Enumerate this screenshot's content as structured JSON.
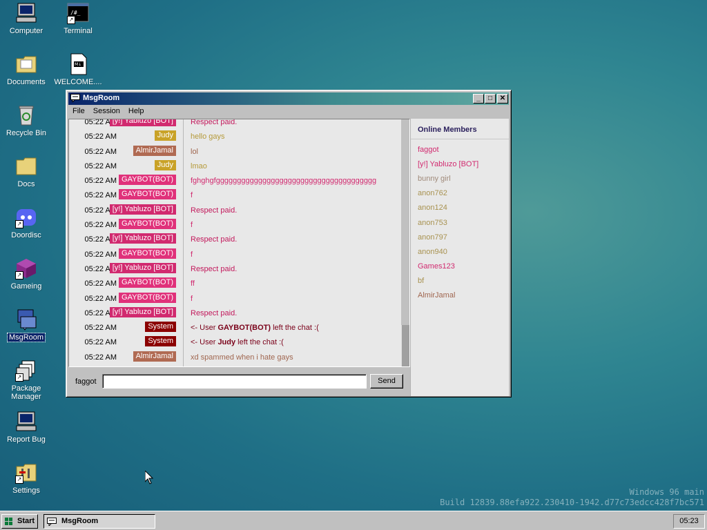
{
  "desktop": {
    "icons": [
      {
        "label": "Computer"
      },
      {
        "label": "Terminal"
      },
      {
        "label": "Documents"
      },
      {
        "label": "WELCOME...."
      },
      {
        "label": "Recycle Bin"
      },
      {
        "label": "Docs"
      },
      {
        "label": "Doordisc"
      },
      {
        "label": "Gameing"
      },
      {
        "label": "MsgRoom"
      },
      {
        "label": "Package Manager"
      },
      {
        "label": "Report Bug"
      },
      {
        "label": "Settings"
      }
    ],
    "watermark": {
      "line1": "Windows 96 main",
      "line2": "Build 12839.88efa922.230410-1942.d77c73edcc428f7bc571"
    }
  },
  "window": {
    "title": "MsgRoom",
    "menu": [
      "File",
      "Session",
      "Help"
    ],
    "messages": [
      {
        "time": "05:22 AM",
        "user": "[y!] Yabluzo [BOT]",
        "user_color": "#d12a6f",
        "text": "Respect paid.",
        "text_color": "#c2185b"
      },
      {
        "time": "05:22 AM",
        "user": "Judy",
        "user_color": "#c9a227",
        "text": "hello gays",
        "text_color": "#b59a3a"
      },
      {
        "time": "05:22 AM",
        "user": "AlmirJamal",
        "user_color": "#b06a52",
        "text": "lol",
        "text_color": "#a0664f"
      },
      {
        "time": "05:22 AM",
        "user": "Judy",
        "user_color": "#c9a227",
        "text": "lmao",
        "text_color": "#b59a3a"
      },
      {
        "time": "05:22 AM",
        "user": "GAYBOT(BOT)",
        "user_color": "#e0317a",
        "text": "fghghgfgggggggggggggggggggggggggggggggggggggg",
        "text_color": "#d12a6f"
      },
      {
        "time": "05:22 AM",
        "user": "GAYBOT(BOT)",
        "user_color": "#e0317a",
        "text": "f",
        "text_color": "#d12a6f"
      },
      {
        "time": "05:22 AM",
        "user": "[y!] Yabluzo [BOT]",
        "user_color": "#d12a6f",
        "text": "Respect paid.",
        "text_color": "#c2185b"
      },
      {
        "time": "05:22 AM",
        "user": "GAYBOT(BOT)",
        "user_color": "#e0317a",
        "text": "f",
        "text_color": "#d12a6f"
      },
      {
        "time": "05:22 AM",
        "user": "[y!] Yabluzo [BOT]",
        "user_color": "#d12a6f",
        "text": "Respect paid.",
        "text_color": "#c2185b"
      },
      {
        "time": "05:22 AM",
        "user": "GAYBOT(BOT)",
        "user_color": "#e0317a",
        "text": "f",
        "text_color": "#d12a6f"
      },
      {
        "time": "05:22 AM",
        "user": "[y!] Yabluzo [BOT]",
        "user_color": "#d12a6f",
        "text": "Respect paid.",
        "text_color": "#c2185b"
      },
      {
        "time": "05:22 AM",
        "user": "GAYBOT(BOT)",
        "user_color": "#e0317a",
        "text": "ff",
        "text_color": "#d12a6f"
      },
      {
        "time": "05:22 AM",
        "user": "GAYBOT(BOT)",
        "user_color": "#e0317a",
        "text": "f",
        "text_color": "#d12a6f"
      },
      {
        "time": "05:22 AM",
        "user": "[y!] Yabluzo [BOT]",
        "user_color": "#d12a6f",
        "text": "Respect paid.",
        "text_color": "#c2185b"
      },
      {
        "time": "05:22 AM",
        "user": "System",
        "user_color": "#8b0000",
        "system": true,
        "text_prefix": "<- User ",
        "text_name": "GAYBOT(BOT)",
        "text_suffix": " left the chat :(",
        "text_color": "#7a0019"
      },
      {
        "time": "05:22 AM",
        "user": "System",
        "user_color": "#8b0000",
        "system": true,
        "text_prefix": "<- User ",
        "text_name": "Judy",
        "text_suffix": " left the chat :(",
        "text_color": "#7a0019"
      },
      {
        "time": "05:22 AM",
        "user": "AlmirJamal",
        "user_color": "#b06a52",
        "text": "xd spammed when i hate gays",
        "text_color": "#a0664f"
      }
    ],
    "input": {
      "nick": "faggot",
      "value": "",
      "send_label": "Send"
    },
    "members": {
      "heading": "Online Members",
      "list": [
        {
          "name": "faggot",
          "color": "#d12a6f"
        },
        {
          "name": "[y!] Yabluzo [BOT]",
          "color": "#d12a6f"
        },
        {
          "name": "bunny girl",
          "color": "#a08a7a"
        },
        {
          "name": "anon762",
          "color": "#a89250"
        },
        {
          "name": "anon124",
          "color": "#a89250"
        },
        {
          "name": "anon753",
          "color": "#a89250"
        },
        {
          "name": "anon797",
          "color": "#a89250"
        },
        {
          "name": "anon940",
          "color": "#a89250"
        },
        {
          "name": "Games123",
          "color": "#d12a6f"
        },
        {
          "name": "bf",
          "color": "#a89250"
        },
        {
          "name": "AlmirJamal",
          "color": "#a0664f"
        }
      ]
    }
  },
  "taskbar": {
    "start_label": "Start",
    "task": "MsgRoom",
    "clock": "05:23"
  }
}
